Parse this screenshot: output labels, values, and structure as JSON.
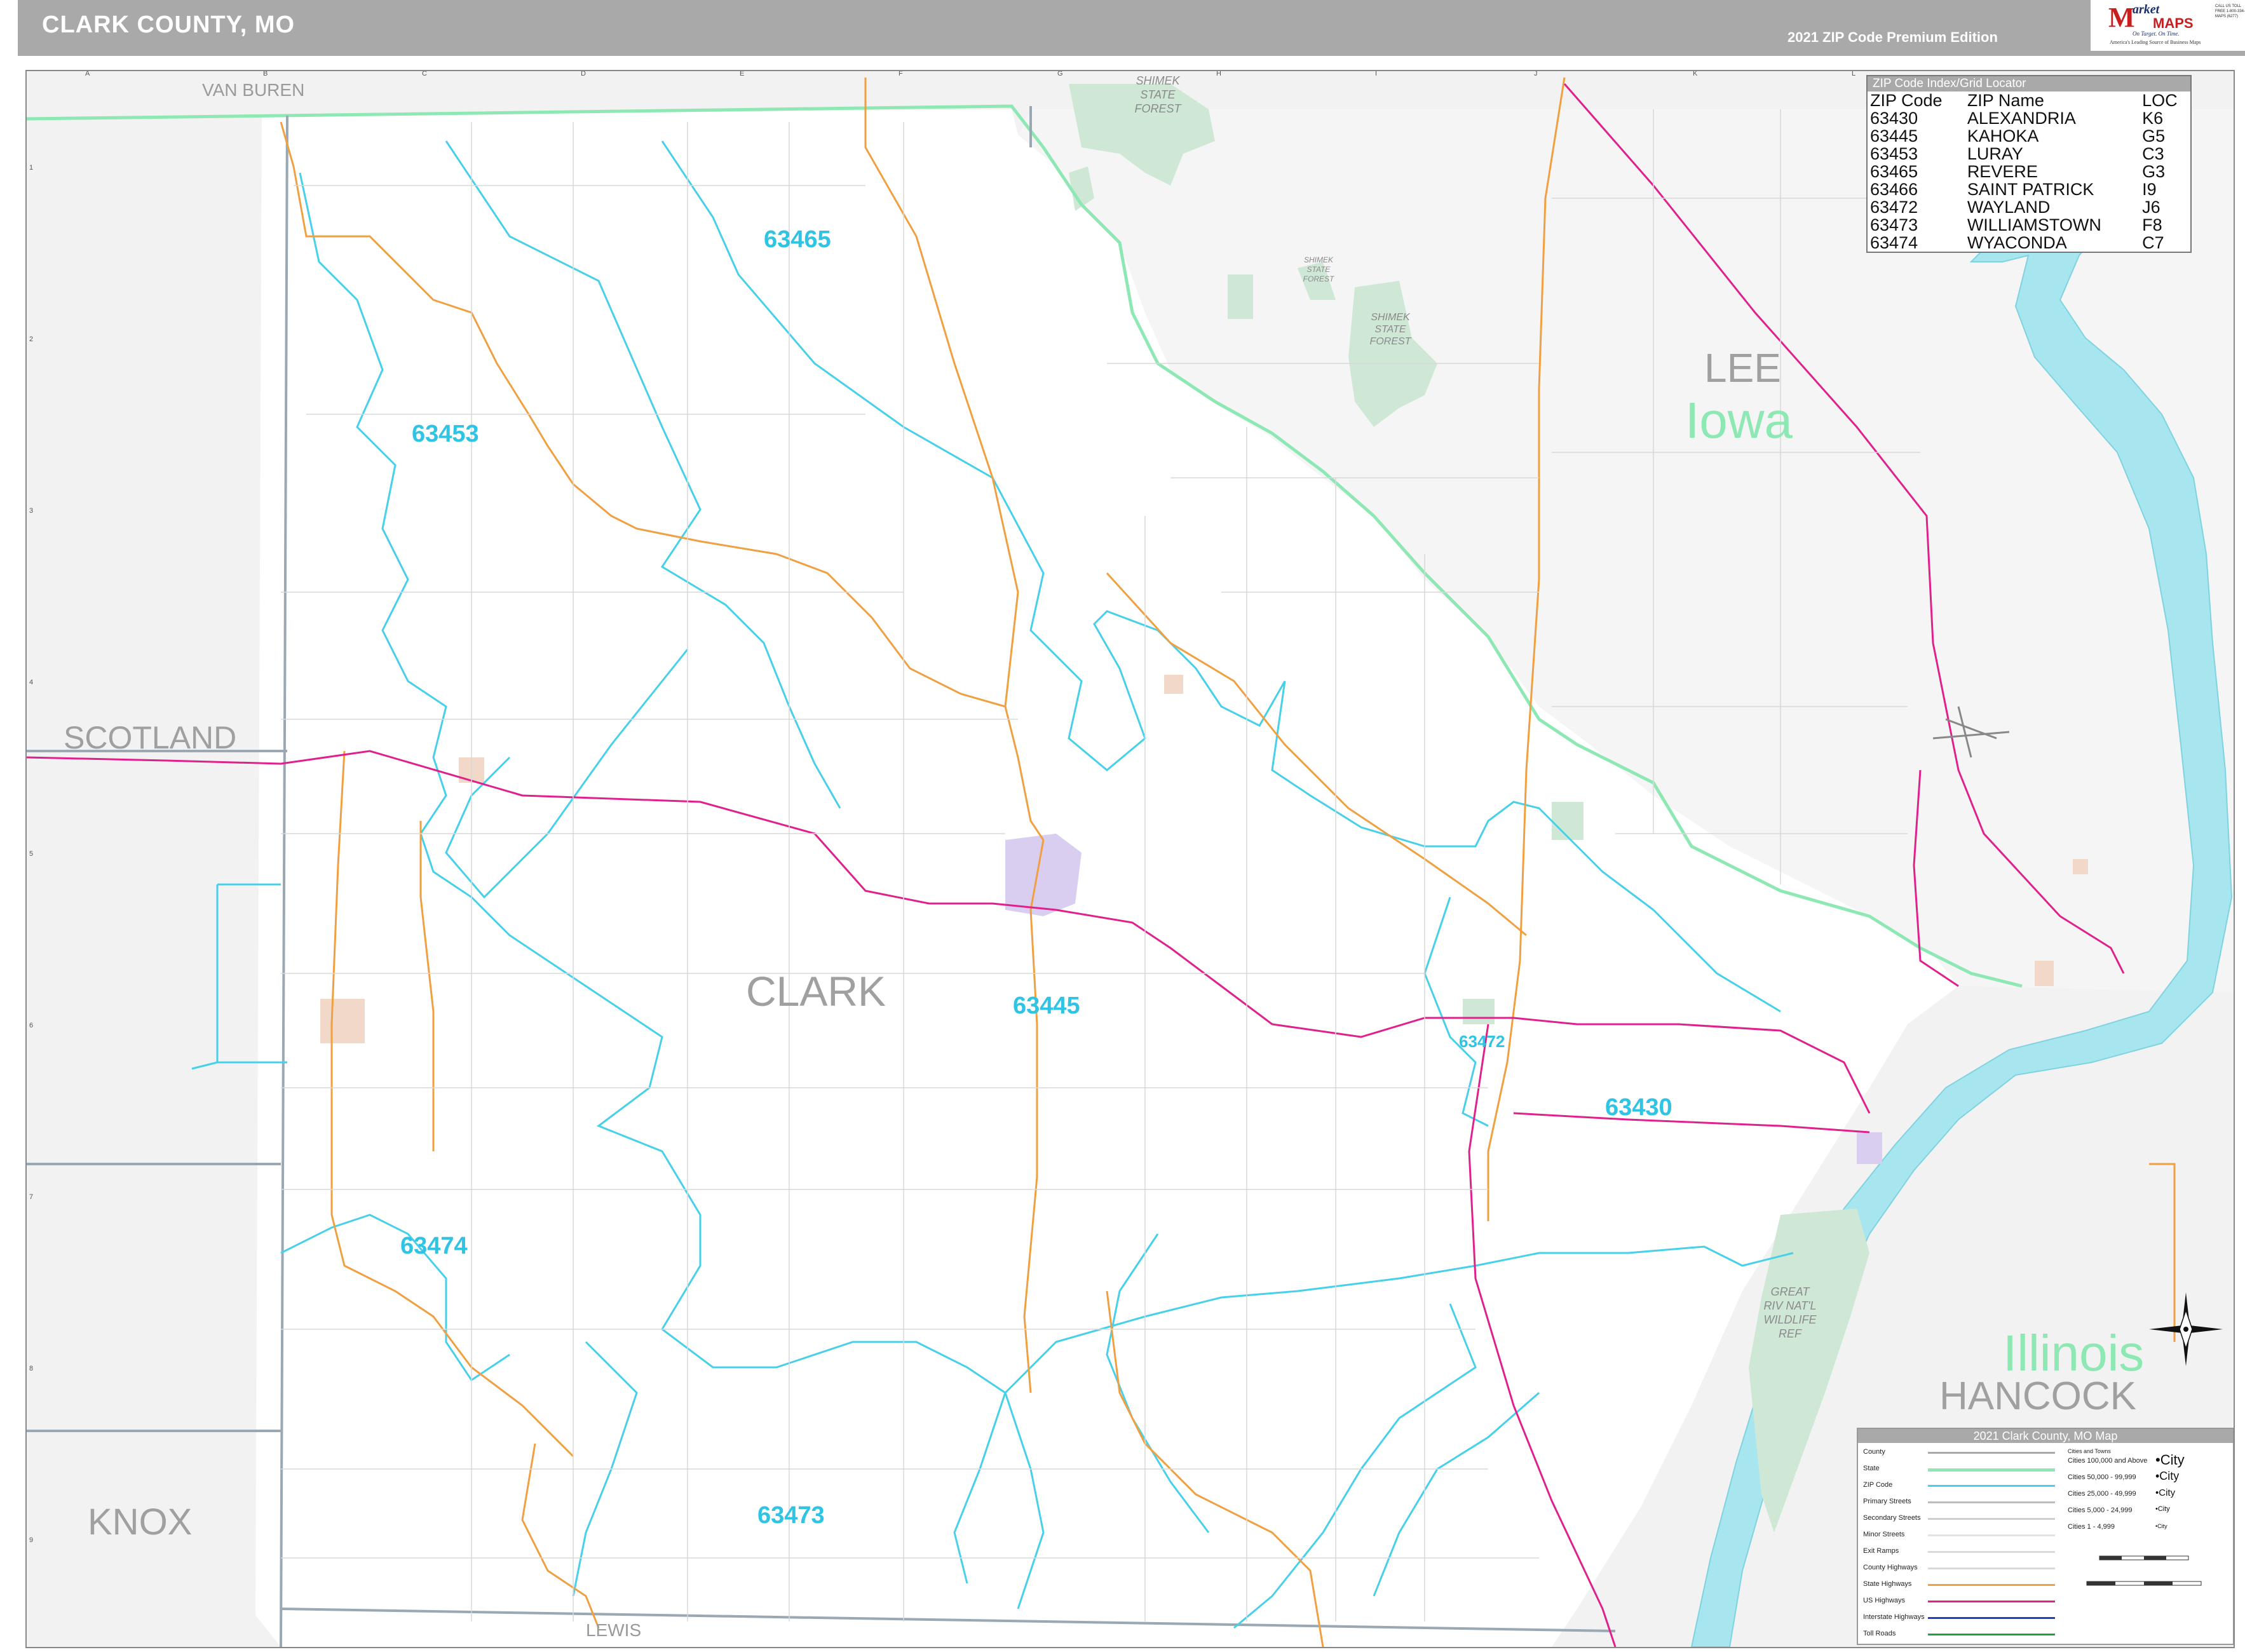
{
  "header": {
    "title": "CLARK COUNTY, MO",
    "edition": "2021 ZIP Code Premium Edition"
  },
  "logo": {
    "m": "M",
    "arket": "arket",
    "maps": "MAPS",
    "tagline": "On Target. On Time.",
    "tagline2": "America's Leading Source of Business Maps",
    "contact": "CALL US TOLL FREE 1-800-334-MAPS (6277)"
  },
  "grid": {
    "columns": [
      "A",
      "B",
      "C",
      "D",
      "E",
      "F",
      "G",
      "H",
      "I",
      "J",
      "K",
      "L"
    ],
    "rows": [
      "1",
      "2",
      "3",
      "4",
      "5",
      "6",
      "7",
      "8",
      "9"
    ]
  },
  "labels": {
    "counties": {
      "van_buren": "VAN BUREN",
      "scotland": "SCOTLAND",
      "knox": "KNOX",
      "clark": "CLARK",
      "lewis": "LEWIS",
      "lee": "LEE",
      "hancock": "HANCOCK"
    },
    "states": {
      "iowa": "Iowa",
      "illinois": "Illinois"
    },
    "zips": {
      "z63465": "63465",
      "z63453": "63453",
      "z63445": "63445",
      "z63472": "63472",
      "z63430": "63430",
      "z63474": "63474",
      "z63473": "63473"
    },
    "parks": {
      "shimek1": "SHIMEK STATE FOREST",
      "shimek2": "SHIMEK STATE FOREST",
      "shimek3": "SHIMEK STATE FOREST",
      "great_river": "GREAT RIV NAT'L WILDLIFE REF"
    }
  },
  "zip_index": {
    "title": "ZIP Code Index/Grid Locator",
    "headers": [
      "ZIP Code",
      "ZIP Name",
      "LOC"
    ],
    "rows": [
      [
        "63430",
        "ALEXANDRIA",
        "K6"
      ],
      [
        "63445",
        "KAHOKA",
        "G5"
      ],
      [
        "63453",
        "LURAY",
        "C3"
      ],
      [
        "63465",
        "REVERE",
        "G3"
      ],
      [
        "63466",
        "SAINT PATRICK",
        "I9"
      ],
      [
        "63472",
        "WAYLAND",
        "J6"
      ],
      [
        "63473",
        "WILLIAMSTOWN",
        "F8"
      ],
      [
        "63474",
        "WYACONDA",
        "C7"
      ]
    ]
  },
  "legend": {
    "title": "2021 Clark County, MO Map",
    "items": [
      {
        "label": "County",
        "color": "#a9a9a9"
      },
      {
        "label": "State",
        "color": "#8ee8b4"
      },
      {
        "label": "ZIP Code",
        "color": "#46d0ea"
      },
      {
        "label": "Primary Streets",
        "color": "#bdbdbd"
      },
      {
        "label": "Secondary Streets",
        "color": "#cfcfcf"
      },
      {
        "label": "Minor Streets",
        "color": "#e2e2e2"
      },
      {
        "label": "Exit Ramps",
        "color": "#d9d9d9"
      },
      {
        "label": "County Highways",
        "color": "#d9d9d9"
      },
      {
        "label": "State Highways",
        "color": "#f0a040"
      },
      {
        "label": "US Highways",
        "color": "#e0208c"
      },
      {
        "label": "Interstate Highways",
        "color": "#2040c0"
      },
      {
        "label": "Toll Roads",
        "color": "#20a040"
      }
    ],
    "cities_title": "Cities and Towns",
    "cities": [
      {
        "label": "Cities 100,000 and Above",
        "sym": "•City"
      },
      {
        "label": "Cities 50,000 - 99,999",
        "sym": "•City"
      },
      {
        "label": "Cities 25,000 - 49,999",
        "sym": "•City"
      },
      {
        "label": "Cities 5,000 - 24,999",
        "sym": "•City"
      },
      {
        "label": "Cities 1 - 4,999",
        "sym": "•City"
      }
    ]
  },
  "colors": {
    "zip_boundary": "#46d0ea",
    "state_boundary": "#8ee8b4",
    "county_boundary": "#9aa8b4",
    "us_highway": "#e0208c",
    "state_highway": "#f0a040",
    "river": "#a8e6ef",
    "forest": "#cfe8d6",
    "urban": "#d9cdf0",
    "town": "#f2d8c8",
    "outside": "#f2f2f2"
  }
}
